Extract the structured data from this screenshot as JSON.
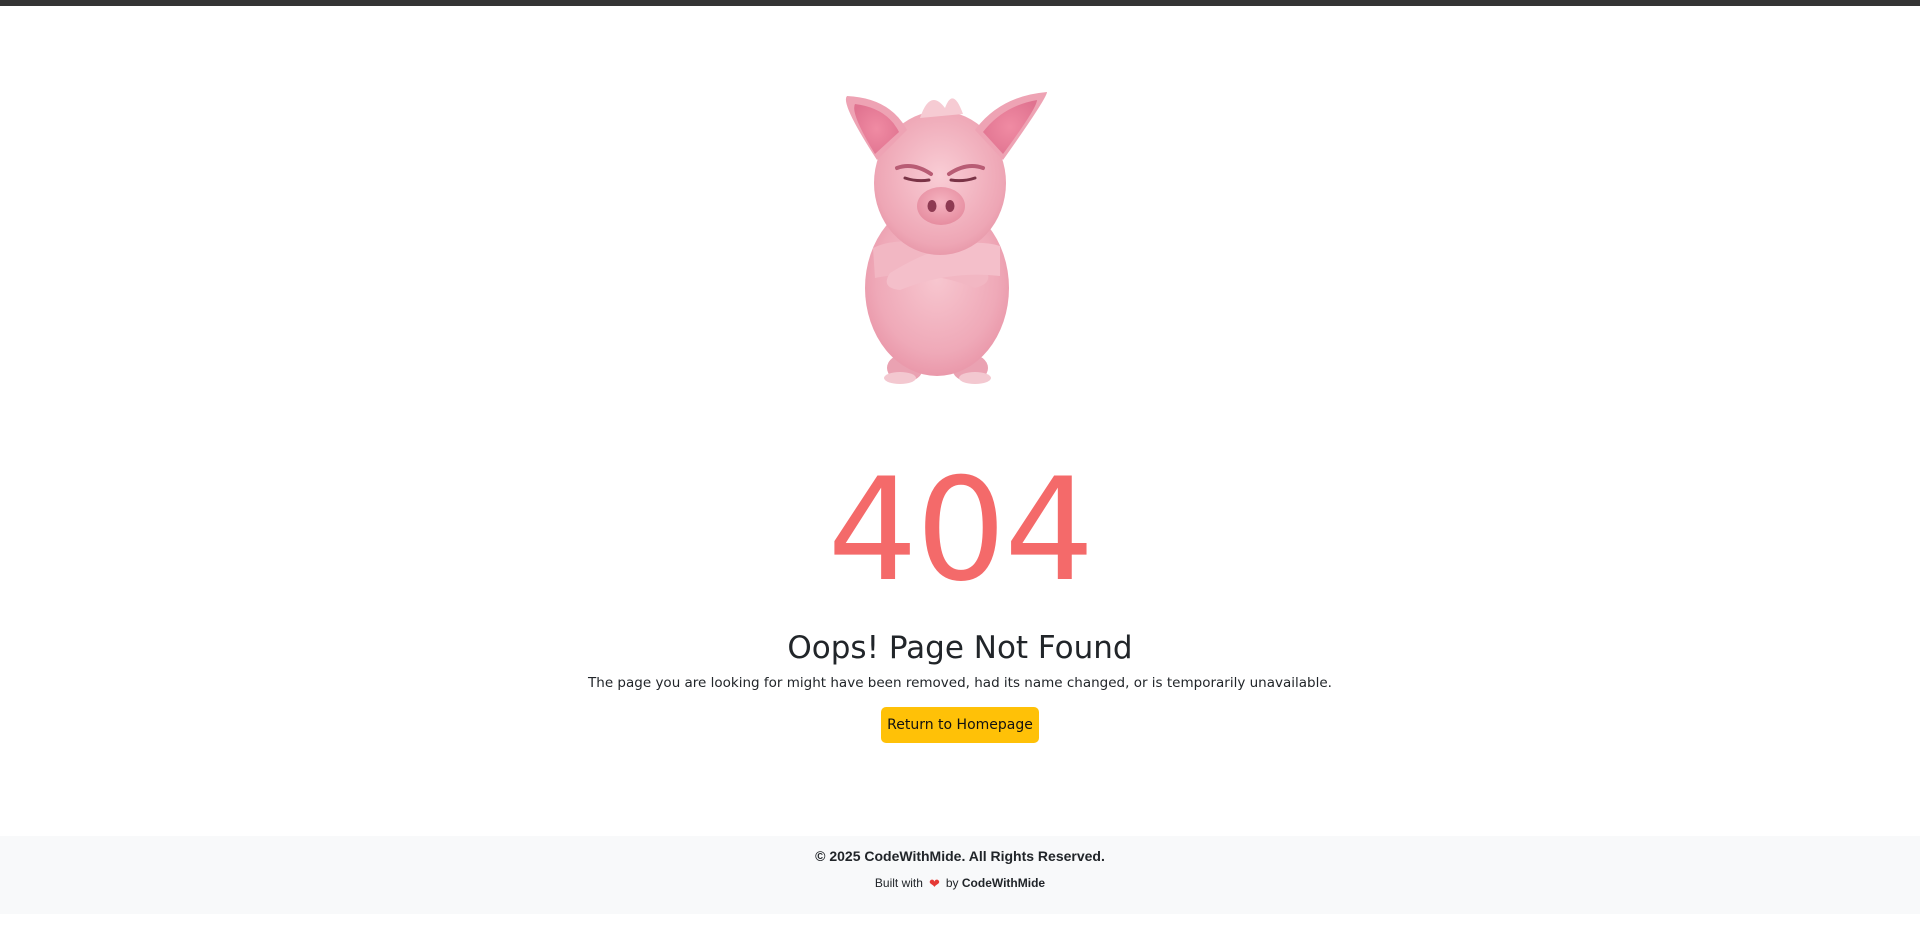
{
  "error": {
    "code": "404",
    "title": "Oops! Page Not Found",
    "description": "The page you are looking for might have been removed, had its name changed, or is temporarily unavailable.",
    "button_label": "Return to Homepage"
  },
  "footer": {
    "copyright": "© 2025 CodeWithMide. All Rights Reserved.",
    "built_prefix": "Built with",
    "built_by": "by",
    "brand": "CodeWithMide",
    "heart_icon": "heart-icon"
  },
  "colors": {
    "code": "#f46a6a",
    "button": "#ffc107",
    "footer_bg": "#f8f9fa",
    "heart": "#e53935"
  }
}
